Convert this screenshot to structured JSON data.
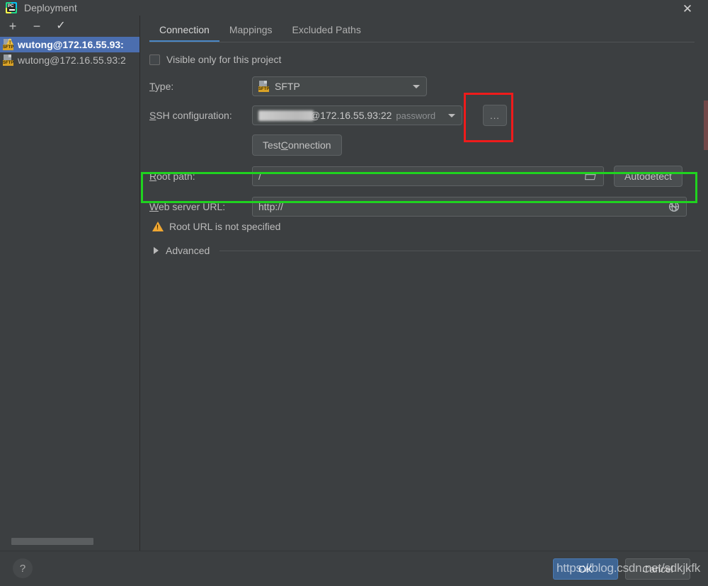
{
  "window": {
    "title": "Deployment",
    "app_icon": "pycharm-icon",
    "close_icon": "close-icon"
  },
  "sidebar": {
    "toolbar": [
      {
        "name": "add-server-button",
        "icon": "plus-icon",
        "label": "+"
      },
      {
        "name": "remove-server-button",
        "icon": "minus-icon",
        "label": "−"
      },
      {
        "name": "set-default-server-button",
        "icon": "check-icon",
        "label": "✓"
      }
    ],
    "servers": [
      {
        "label": "wutong@172.16.55.93:",
        "icon": "sftp-warning-icon",
        "selected": true
      },
      {
        "label": "wutong@172.16.55.93:2",
        "icon": "sftp-icon",
        "selected": false
      }
    ],
    "scrollbar": "horizontal-scrollbar"
  },
  "tabs": [
    {
      "label": "Connection",
      "active": true
    },
    {
      "label": "Mappings",
      "active": false
    },
    {
      "label": "Excluded Paths",
      "active": false
    }
  ],
  "form": {
    "visible_only_checkbox": {
      "label": "Visible only for this project",
      "checked": false
    },
    "type": {
      "label": "Type:",
      "label_mnemonic": "T",
      "value": "SFTP",
      "icon": "sftp-icon",
      "caret": "chevron-down-icon"
    },
    "ssh_configuration": {
      "label": "SSH configuration:",
      "label_mnemonic": "S",
      "value": "@172.16.55.93:22",
      "redacted_username": true,
      "auth_type": "password",
      "caret": "chevron-down-icon",
      "browse_button": "...",
      "browse_button_name": "ssh-config-browse-button"
    },
    "test_connection": {
      "label": "Test Connection",
      "label_mnemonic": "C"
    },
    "root_path": {
      "label": "Root path:",
      "label_mnemonic": "R",
      "value": "/",
      "folder_icon": "folder-icon",
      "autodetect_label": "Autodetect"
    },
    "web_server_url": {
      "label": "Web server URL:",
      "label_mnemonic": "W",
      "value": "http://",
      "globe_icon": "globe-icon"
    },
    "warning": {
      "icon": "warning-triangle-icon",
      "text": "Root URL is not specified"
    },
    "advanced": {
      "label": "Advanced",
      "caret": "chevron-right-icon",
      "expanded": false
    }
  },
  "footer": {
    "help_label": "?",
    "ok_label": "OK",
    "cancel_label": "Cancel"
  },
  "watermark": {
    "text": "https://blog.csdn.net/sdkjkfk"
  },
  "annotations": {
    "red_box": {
      "target": "ssh-config-browse-button",
      "color": "#ef1b1b"
    },
    "green_box": {
      "target": "root-path-row",
      "color": "#1fd31f"
    }
  }
}
